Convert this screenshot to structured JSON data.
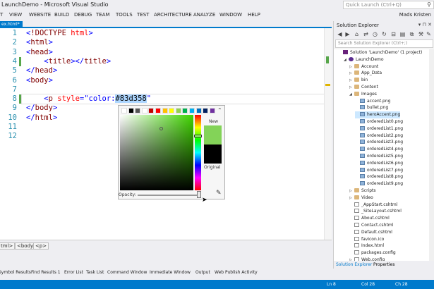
{
  "window": {
    "title": "LaunchDemo - Microsoft Visual Studio",
    "quick_launch_placeholder": "Quick Launch (Ctrl+Q)",
    "user": "Mads Kristen"
  },
  "menu": [
    "T",
    "VIEW",
    "WEBSITE",
    "BUILD",
    "DEBUG",
    "TEAM",
    "TOOLS",
    "TEST",
    "ARCHITECTURE",
    "ANALYZE",
    "WINDOW",
    "HELP"
  ],
  "document_tab": "ex.html*",
  "editor": {
    "line_numbers": [
      "1",
      "2",
      "3",
      "4",
      "5",
      "6",
      "7",
      "8",
      "9",
      "10",
      "11",
      "12"
    ],
    "lines": [
      {
        "indent": "",
        "parts": [
          [
            "br",
            "<"
          ],
          [
            "tag",
            "!DOCTYPE"
          ],
          [
            "br",
            " "
          ],
          [
            "attr",
            "html"
          ],
          [
            "br",
            ">"
          ]
        ]
      },
      {
        "indent": "",
        "parts": [
          [
            "br",
            "<"
          ],
          [
            "tag",
            "html"
          ],
          [
            "br",
            ">"
          ]
        ]
      },
      {
        "indent": "",
        "parts": [
          [
            "br",
            "<"
          ],
          [
            "tag",
            "head"
          ],
          [
            "br",
            ">"
          ]
        ]
      },
      {
        "indent": "    ",
        "parts": [
          [
            "br",
            "<"
          ],
          [
            "tag",
            "title"
          ],
          [
            "br",
            "></"
          ],
          [
            "tag",
            "title"
          ],
          [
            "br",
            ">"
          ]
        ]
      },
      {
        "indent": "",
        "parts": [
          [
            "br",
            "</"
          ],
          [
            "tag",
            "head"
          ],
          [
            "br",
            ">"
          ]
        ]
      },
      {
        "indent": "",
        "parts": [
          [
            "br",
            "<"
          ],
          [
            "tag",
            "body"
          ],
          [
            "br",
            ">"
          ]
        ]
      },
      {
        "indent": "",
        "parts": []
      },
      {
        "indent": "    ",
        "parts": [
          [
            "br",
            "<"
          ],
          [
            "tag",
            "p"
          ],
          [
            "br",
            " "
          ],
          [
            "attr",
            "style"
          ],
          [
            "br",
            "=\""
          ],
          [
            "val",
            "color:"
          ],
          [
            "sel",
            "#83d358"
          ],
          [
            "br",
            "\""
          ]
        ]
      },
      {
        "indent": "",
        "parts": [
          [
            "br",
            "</"
          ],
          [
            "tag",
            "body"
          ],
          [
            "br",
            ">"
          ]
        ]
      },
      {
        "indent": "",
        "parts": [
          [
            "br",
            "</"
          ],
          [
            "tag",
            "html"
          ],
          [
            "br",
            ">"
          ]
        ]
      },
      {
        "indent": "",
        "parts": []
      },
      {
        "indent": "",
        "parts": []
      }
    ]
  },
  "color_picker": {
    "swatches": [
      "#ffffff",
      "#000000",
      "#555555",
      "#ffffff",
      "#c00000",
      "#ff0000",
      "#ffc000",
      "#ffff00",
      "#92d050",
      "#00b050",
      "#00b0f0",
      "#0070c0",
      "#002060",
      "#7030a0"
    ],
    "new_label": "New",
    "new_color": "#83d358",
    "original_label": "Original",
    "original_color": "#000000",
    "opacity_label": "Opacity:",
    "opacity": 1.0
  },
  "breadcrumbs": [
    "tml>",
    "<body>",
    "<p>"
  ],
  "tool_tabs": [
    "Symbol Results",
    "Find Results 1",
    "Error List",
    "Task List",
    "Command Window",
    "Immediate Window",
    "Output",
    "Web Publish Activity"
  ],
  "status": {
    "line": "Ln 8",
    "col": "Col 28",
    "ch": "Ch 28"
  },
  "solution_explorer": {
    "title": "Solution Explorer",
    "search_placeholder": "Search Solution Explorer (Ctrl+;)",
    "tree": [
      {
        "label": "Solution 'LaunchDemo' (1 project)",
        "level": 0,
        "icon": "sol",
        "arrow": ""
      },
      {
        "label": "LaunchDemo",
        "level": 1,
        "icon": "proj",
        "arrow": "◢"
      },
      {
        "label": "Account",
        "level": 2,
        "icon": "folder",
        "arrow": "▷"
      },
      {
        "label": "App_Data",
        "level": 2,
        "icon": "folder",
        "arrow": "▷"
      },
      {
        "label": "bin",
        "level": 2,
        "icon": "folder",
        "arrow": "▷"
      },
      {
        "label": "Content",
        "level": 2,
        "icon": "folder",
        "arrow": "▷"
      },
      {
        "label": "Images",
        "level": 2,
        "icon": "folder",
        "arrow": "◢"
      },
      {
        "label": "accent.png",
        "level": 3,
        "icon": "img",
        "arrow": ""
      },
      {
        "label": "bullet.png",
        "level": 3,
        "icon": "img",
        "arrow": ""
      },
      {
        "label": "heroAccent.png",
        "level": 3,
        "icon": "img",
        "arrow": "",
        "selected": true
      },
      {
        "label": "orderedList0.png",
        "level": 3,
        "icon": "img",
        "arrow": ""
      },
      {
        "label": "orderedList1.png",
        "level": 3,
        "icon": "img",
        "arrow": ""
      },
      {
        "label": "orderedList2.png",
        "level": 3,
        "icon": "img",
        "arrow": ""
      },
      {
        "label": "orderedList3.png",
        "level": 3,
        "icon": "img",
        "arrow": ""
      },
      {
        "label": "orderedList4.png",
        "level": 3,
        "icon": "img",
        "arrow": ""
      },
      {
        "label": "orderedList5.png",
        "level": 3,
        "icon": "img",
        "arrow": ""
      },
      {
        "label": "orderedList6.png",
        "level": 3,
        "icon": "img",
        "arrow": ""
      },
      {
        "label": "orderedList7.png",
        "level": 3,
        "icon": "img",
        "arrow": ""
      },
      {
        "label": "orderedList8.png",
        "level": 3,
        "icon": "img",
        "arrow": ""
      },
      {
        "label": "orderedList9.png",
        "level": 3,
        "icon": "img",
        "arrow": ""
      },
      {
        "label": "Scripts",
        "level": 2,
        "icon": "folder",
        "arrow": "▷"
      },
      {
        "label": "Video",
        "level": 2,
        "icon": "folder",
        "arrow": "▷"
      },
      {
        "label": "_AppStart.cshtml",
        "level": 2,
        "icon": "file",
        "arrow": ""
      },
      {
        "label": "_SiteLayout.cshtml",
        "level": 2,
        "icon": "file",
        "arrow": ""
      },
      {
        "label": "About.cshtml",
        "level": 2,
        "icon": "file",
        "arrow": ""
      },
      {
        "label": "Contact.cshtml",
        "level": 2,
        "icon": "file",
        "arrow": ""
      },
      {
        "label": "Default.cshtml",
        "level": 2,
        "icon": "file",
        "arrow": ""
      },
      {
        "label": "favicon.ico",
        "level": 2,
        "icon": "file",
        "arrow": ""
      },
      {
        "label": "Index.html",
        "level": 2,
        "icon": "file",
        "arrow": ""
      },
      {
        "label": "packages.config",
        "level": 2,
        "icon": "file",
        "arrow": ""
      },
      {
        "label": "Web.config",
        "level": 2,
        "icon": "file",
        "arrow": "▷"
      }
    ],
    "bottom_tabs": [
      "Solution Explorer",
      "Properties"
    ]
  }
}
